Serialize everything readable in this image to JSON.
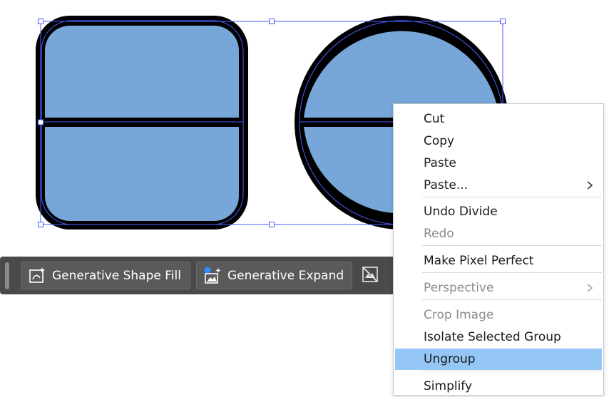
{
  "context_menu": {
    "items": [
      {
        "label": "Cut",
        "enabled": true
      },
      {
        "label": "Copy",
        "enabled": true
      },
      {
        "label": "Paste",
        "enabled": true
      },
      {
        "label": "Paste...",
        "enabled": true,
        "has_submenu": true
      },
      {
        "label": "Undo Divide",
        "enabled": true
      },
      {
        "label": "Redo",
        "enabled": false
      },
      {
        "label": "Make Pixel Perfect",
        "enabled": true
      },
      {
        "label": "Perspective",
        "enabled": false,
        "has_submenu": true
      },
      {
        "label": "Crop Image",
        "enabled": false
      },
      {
        "label": "Isolate Selected Group",
        "enabled": true
      },
      {
        "label": "Ungroup",
        "enabled": true,
        "highlighted": true
      },
      {
        "label": "Simplify",
        "enabled": true
      }
    ],
    "highlight_color": "#94c7f5"
  },
  "taskbar": {
    "generative_shape_fill_label": "Generative Shape Fill",
    "generative_expand_label": "Generative Expand",
    "icons": {
      "shape_fill": "generative-shape-fill-icon",
      "expand": "generative-expand-icon",
      "extra": "hide-taskbar-icon"
    }
  },
  "artwork": {
    "fill_color": "#77a6d8",
    "stroke_color": "#000000",
    "selection_color": "#4a5cff"
  }
}
